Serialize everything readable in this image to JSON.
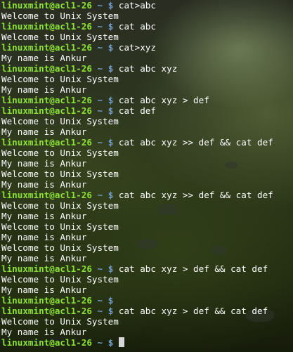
{
  "terminal": {
    "lines": [
      {
        "type": "prompt",
        "user": "linuxmint@acl1-26",
        "dir": "~",
        "symbol": "$",
        "command": "cat>abc"
      },
      {
        "type": "output",
        "text": "Welcome to Unix System"
      },
      {
        "type": "prompt",
        "user": "linuxmint@acl1-26",
        "dir": "~",
        "symbol": "$",
        "command": "cat abc"
      },
      {
        "type": "output",
        "text": "Welcome to Unix System"
      },
      {
        "type": "prompt",
        "user": "linuxmint@acl1-26",
        "dir": "~",
        "symbol": "$",
        "command": "cat>xyz"
      },
      {
        "type": "output",
        "text": "My name is Ankur"
      },
      {
        "type": "prompt",
        "user": "linuxmint@acl1-26",
        "dir": "~",
        "symbol": "$",
        "command": "cat abc xyz"
      },
      {
        "type": "output",
        "text": "Welcome to Unix System"
      },
      {
        "type": "output",
        "text": "My name is Ankur"
      },
      {
        "type": "prompt",
        "user": "linuxmint@acl1-26",
        "dir": "~",
        "symbol": "$",
        "command": "cat abc xyz > def"
      },
      {
        "type": "prompt",
        "user": "linuxmint@acl1-26",
        "dir": "~",
        "symbol": "$",
        "command": "cat def"
      },
      {
        "type": "output",
        "text": "Welcome to Unix System"
      },
      {
        "type": "output",
        "text": "My name is Ankur"
      },
      {
        "type": "prompt",
        "user": "linuxmint@acl1-26",
        "dir": "~",
        "symbol": "$",
        "command": "cat abc xyz >> def && cat def"
      },
      {
        "type": "output",
        "text": "Welcome to Unix System"
      },
      {
        "type": "output",
        "text": "My name is Ankur"
      },
      {
        "type": "output",
        "text": "Welcome to Unix System"
      },
      {
        "type": "output",
        "text": "My name is Ankur"
      },
      {
        "type": "prompt",
        "user": "linuxmint@acl1-26",
        "dir": "~",
        "symbol": "$",
        "command": "cat abc xyz >> def && cat def"
      },
      {
        "type": "output",
        "text": "Welcome to Unix System"
      },
      {
        "type": "output",
        "text": "My name is Ankur"
      },
      {
        "type": "output",
        "text": "Welcome to Unix System"
      },
      {
        "type": "output",
        "text": "My name is Ankur"
      },
      {
        "type": "output",
        "text": "Welcome to Unix System"
      },
      {
        "type": "output",
        "text": "My name is Ankur"
      },
      {
        "type": "prompt",
        "user": "linuxmint@acl1-26",
        "dir": "~",
        "symbol": "$",
        "command": "cat abc xyz > def && cat def"
      },
      {
        "type": "output",
        "text": "Welcome to Unix System"
      },
      {
        "type": "output",
        "text": "My name is Ankur"
      },
      {
        "type": "prompt",
        "user": "linuxmint@acl1-26",
        "dir": "~",
        "symbol": "$",
        "command": ""
      },
      {
        "type": "prompt",
        "user": "linuxmint@acl1-26",
        "dir": "~",
        "symbol": "$",
        "command": "cat abc xyz > def && cat def"
      },
      {
        "type": "output",
        "text": "Welcome to Unix System"
      },
      {
        "type": "output",
        "text": "My name is Ankur"
      },
      {
        "type": "prompt",
        "user": "linuxmint@acl1-26",
        "dir": "~",
        "symbol": "$",
        "command": "",
        "cursor": true
      }
    ]
  },
  "colors": {
    "prompt_user": "#8ae234",
    "prompt_dir": "#729fcf",
    "text": "#ffffff",
    "cursor": "#d8d8d8"
  }
}
